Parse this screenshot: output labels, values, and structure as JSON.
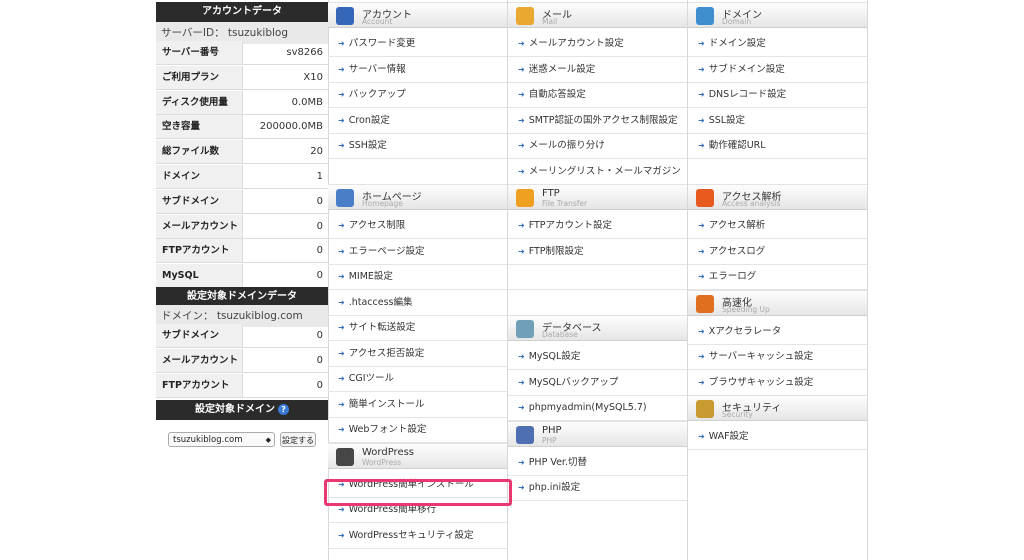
{
  "sidebar": {
    "account_header": "アカウントデータ",
    "server_id": "サーバーID： tsuzukiblog",
    "account_rows": [
      {
        "k": "サーバー番号",
        "v": "sv8266"
      },
      {
        "k": "ご利用プラン",
        "v": "X10"
      },
      {
        "k": "ディスク使用量",
        "v": "0.0MB"
      },
      {
        "k": "空き容量",
        "v": "200000.0MB"
      },
      {
        "k": "総ファイル数",
        "v": "20"
      },
      {
        "k": "ドメイン",
        "v": "1"
      },
      {
        "k": "サブドメイン",
        "v": "0"
      },
      {
        "k": "メールアカウント",
        "v": "0"
      },
      {
        "k": "FTPアカウント",
        "v": "0"
      },
      {
        "k": "MySQL",
        "v": "0"
      }
    ],
    "domain_header": "設定対象ドメインデータ",
    "domain_line": "ドメイン： tsuzukiblog.com",
    "domain_rows": [
      {
        "k": "サブドメイン",
        "v": "0"
      },
      {
        "k": "メールアカウント",
        "v": "0"
      },
      {
        "k": "FTPアカウント",
        "v": "0"
      }
    ],
    "target_header": "設定対象ドメイン",
    "help": "?",
    "select_value": "tsuzukiblog.com",
    "set_button": "設定する"
  },
  "columns": [
    {
      "sections": [
        {
          "title": "アカウント",
          "sub": "Account",
          "icon": "account-icon",
          "color": "#3566b8",
          "items": [
            "パスワード変更",
            "サーバー情報",
            "バックアップ",
            "Cron設定",
            "SSH設定",
            ""
          ]
        },
        {
          "title": "ホームページ",
          "sub": "Homepage",
          "icon": "homepage-icon",
          "color": "#4a7fc8",
          "items": [
            "アクセス制限",
            "エラーページ設定",
            "MIME設定",
            ".htaccess編集",
            "サイト転送設定",
            "アクセス拒否設定",
            "CGIツール",
            "簡単インストール",
            "Webフォント設定"
          ]
        },
        {
          "title": "WordPress",
          "sub": "WordPress",
          "icon": "wordpress-icon",
          "color": "#464646",
          "items": [
            "WordPress簡単インストール",
            "WordPress簡単移行",
            "WordPressセキュリティ設定"
          ]
        }
      ]
    },
    {
      "sections": [
        {
          "title": "メール",
          "sub": "Mail",
          "icon": "mail-icon",
          "color": "#e9a830",
          "items": [
            "メールアカウント設定",
            "迷惑メール設定",
            "自動応答設定",
            "SMTP認証の国外アクセス制限設定",
            "メールの振り分け",
            "メーリングリスト・メールマガジン"
          ]
        },
        {
          "title": "FTP",
          "sub": "File Transfer",
          "icon": "ftp-icon",
          "color": "#f0a020",
          "items": [
            "FTPアカウント設定",
            "FTP制限設定",
            "",
            ""
          ]
        },
        {
          "title": "データベース",
          "sub": "Database",
          "icon": "database-icon",
          "color": "#6fa0b8",
          "items": [
            "MySQL設定",
            "MySQLバックアップ",
            "phpmyadmin(MySQL5.7)"
          ]
        },
        {
          "title": "PHP",
          "sub": "PHP",
          "icon": "php-icon",
          "color": "#4e70b0",
          "items": [
            "PHP Ver.切替",
            "php.ini設定"
          ]
        }
      ]
    },
    {
      "sections": [
        {
          "title": "ドメイン",
          "sub": "Domain",
          "icon": "domain-icon",
          "color": "#3f8fd0",
          "items": [
            "ドメイン設定",
            "サブドメイン設定",
            "DNSレコード設定",
            "SSL設定",
            "動作確認URL",
            ""
          ]
        },
        {
          "title": "アクセス解析",
          "sub": "Access analysis",
          "icon": "access-analysis-icon",
          "color": "#e65a20",
          "items": [
            "アクセス解析",
            "アクセスログ",
            "エラーログ"
          ]
        },
        {
          "title": "高速化",
          "sub": "Speeding Up",
          "icon": "speeding-up-icon",
          "color": "#e07020",
          "items": [
            "Xアクセラレータ",
            "サーバーキャッシュ設定",
            "ブラウザキャッシュ設定"
          ]
        },
        {
          "title": "セキュリティ",
          "sub": "Security",
          "icon": "security-icon",
          "color": "#c89a30",
          "items": [
            "WAF設定"
          ]
        }
      ]
    }
  ],
  "highlight_color": "#e8386f"
}
